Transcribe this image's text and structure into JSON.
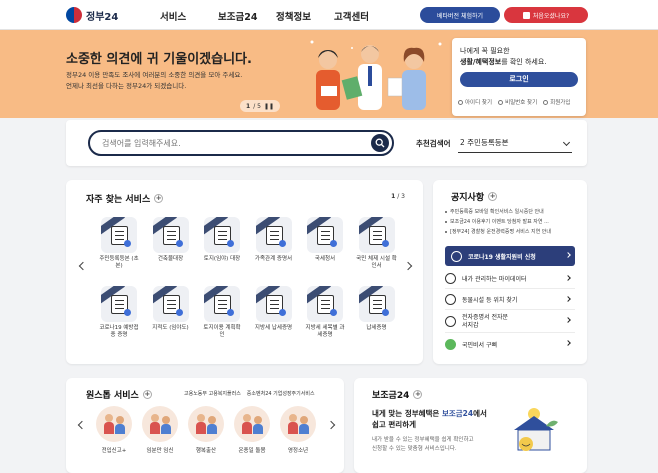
{
  "header": {
    "logo_text": "정부24",
    "nav": [
      "서비스",
      "보조금24",
      "정책정보",
      "고객센터"
    ],
    "beta_button": "베타버전 체험하기",
    "first_visit_button": "처음오셨나요?"
  },
  "hero": {
    "title": "소중한 의견에 귀 기울이겠습니다.",
    "desc_line1": "정부24 이용 만족도 조사에 여러분의 소중한 의견을 모아 주세요.",
    "desc_line2": "언제나 최선을 다하는 정부24가 되겠습니다.",
    "pager_current": "1",
    "pager_total": "/ 5"
  },
  "login": {
    "line1": "나에게 꼭 필요한",
    "line2_bold": "생활/혜택정보",
    "line2_rest": "를 확인 하세요.",
    "button": "로그인",
    "links": [
      "아이디 찾기",
      "비밀번호 찾기",
      "회원가입"
    ]
  },
  "search": {
    "placeholder": "검색어를 입력해주세요.",
    "recommended_label": "추천검색어",
    "recommended_value": "2  주민등록등본"
  },
  "services": {
    "title": "자주 찾는 서비스",
    "page_current": "1",
    "page_total": " / 3",
    "items": [
      {
        "label": "주민등록등본 (초본)"
      },
      {
        "label": "건축물대장"
      },
      {
        "label": "토지(임야) 대장"
      },
      {
        "label": "가족관계 증명서"
      },
      {
        "label": "국세청서"
      },
      {
        "label": "국민 체제 시설 확인서"
      },
      {
        "label": "코로나19 예방접종 증명"
      },
      {
        "label": "지적도 (임야도)"
      },
      {
        "label": "토지이용 계획확인"
      },
      {
        "label": "지방세 납세증명"
      },
      {
        "label": "지방세 세목별 과세증명"
      },
      {
        "label": "납세증명"
      }
    ]
  },
  "notice": {
    "title": "공지사항",
    "items": [
      "주민등록증 모바일 확인서비스 일시중단 안내",
      "보조금24 이용후기 이벤트 당첨자 발표 자연 ...",
      "[정부24] 경찰청 운전경력증명 서비스 지연 안내"
    ],
    "quick": [
      "코로나19 생활지원비 신청",
      "내가 관리하는 마이데이터",
      "동물시설 등 위치 찾기",
      "전자증명서 전자문서지갑",
      "국민비서 구삐"
    ]
  },
  "onestop": {
    "title": "원스톱 서비스",
    "tags": [
      "고용노동부 고용복지플러스",
      "중소벤처24 기업성장주기서비스"
    ],
    "items": [
      "전입신고+",
      "임분만 임신",
      "행복출산",
      "온종일 돌봄",
      "영정소년"
    ]
  },
  "subsidy": {
    "title": "보조금24",
    "head_line1_a": "내게 맞는 정부혜택은 ",
    "head_line1_b": "보조금24",
    "head_line1_c": "에서",
    "head_line2": "쉽고 편리하게",
    "desc_line1": "내가 받을 수 있는 정부혜택을 쉽게 확인하고",
    "desc_line2": "신청할 수 있는 맞춤형 서비스입니다."
  },
  "colors": {
    "hero_bg": "#f8bb85",
    "primary_navy": "#2f4f9c",
    "accent_red": "#d9363e"
  }
}
